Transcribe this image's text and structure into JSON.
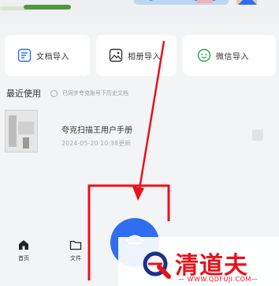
{
  "import": {
    "doc_label": "文档导入",
    "album_label": "相册导入",
    "wechat_label": "微信导入"
  },
  "recent": {
    "title": "最近使用",
    "note": "已同步夸克账号下历史文档"
  },
  "file": {
    "name": "夸克扫描王用户手册",
    "meta": "2024-05-20 10:38更新"
  },
  "tabbar": {
    "home_label": "首页",
    "file_label": "文件"
  },
  "watermark": {
    "brand": "清道夫",
    "url": "— WWW.QDFUJI.COM—"
  },
  "colors": {
    "accent": "#2f6ef0",
    "annotation": "#e8121a"
  }
}
